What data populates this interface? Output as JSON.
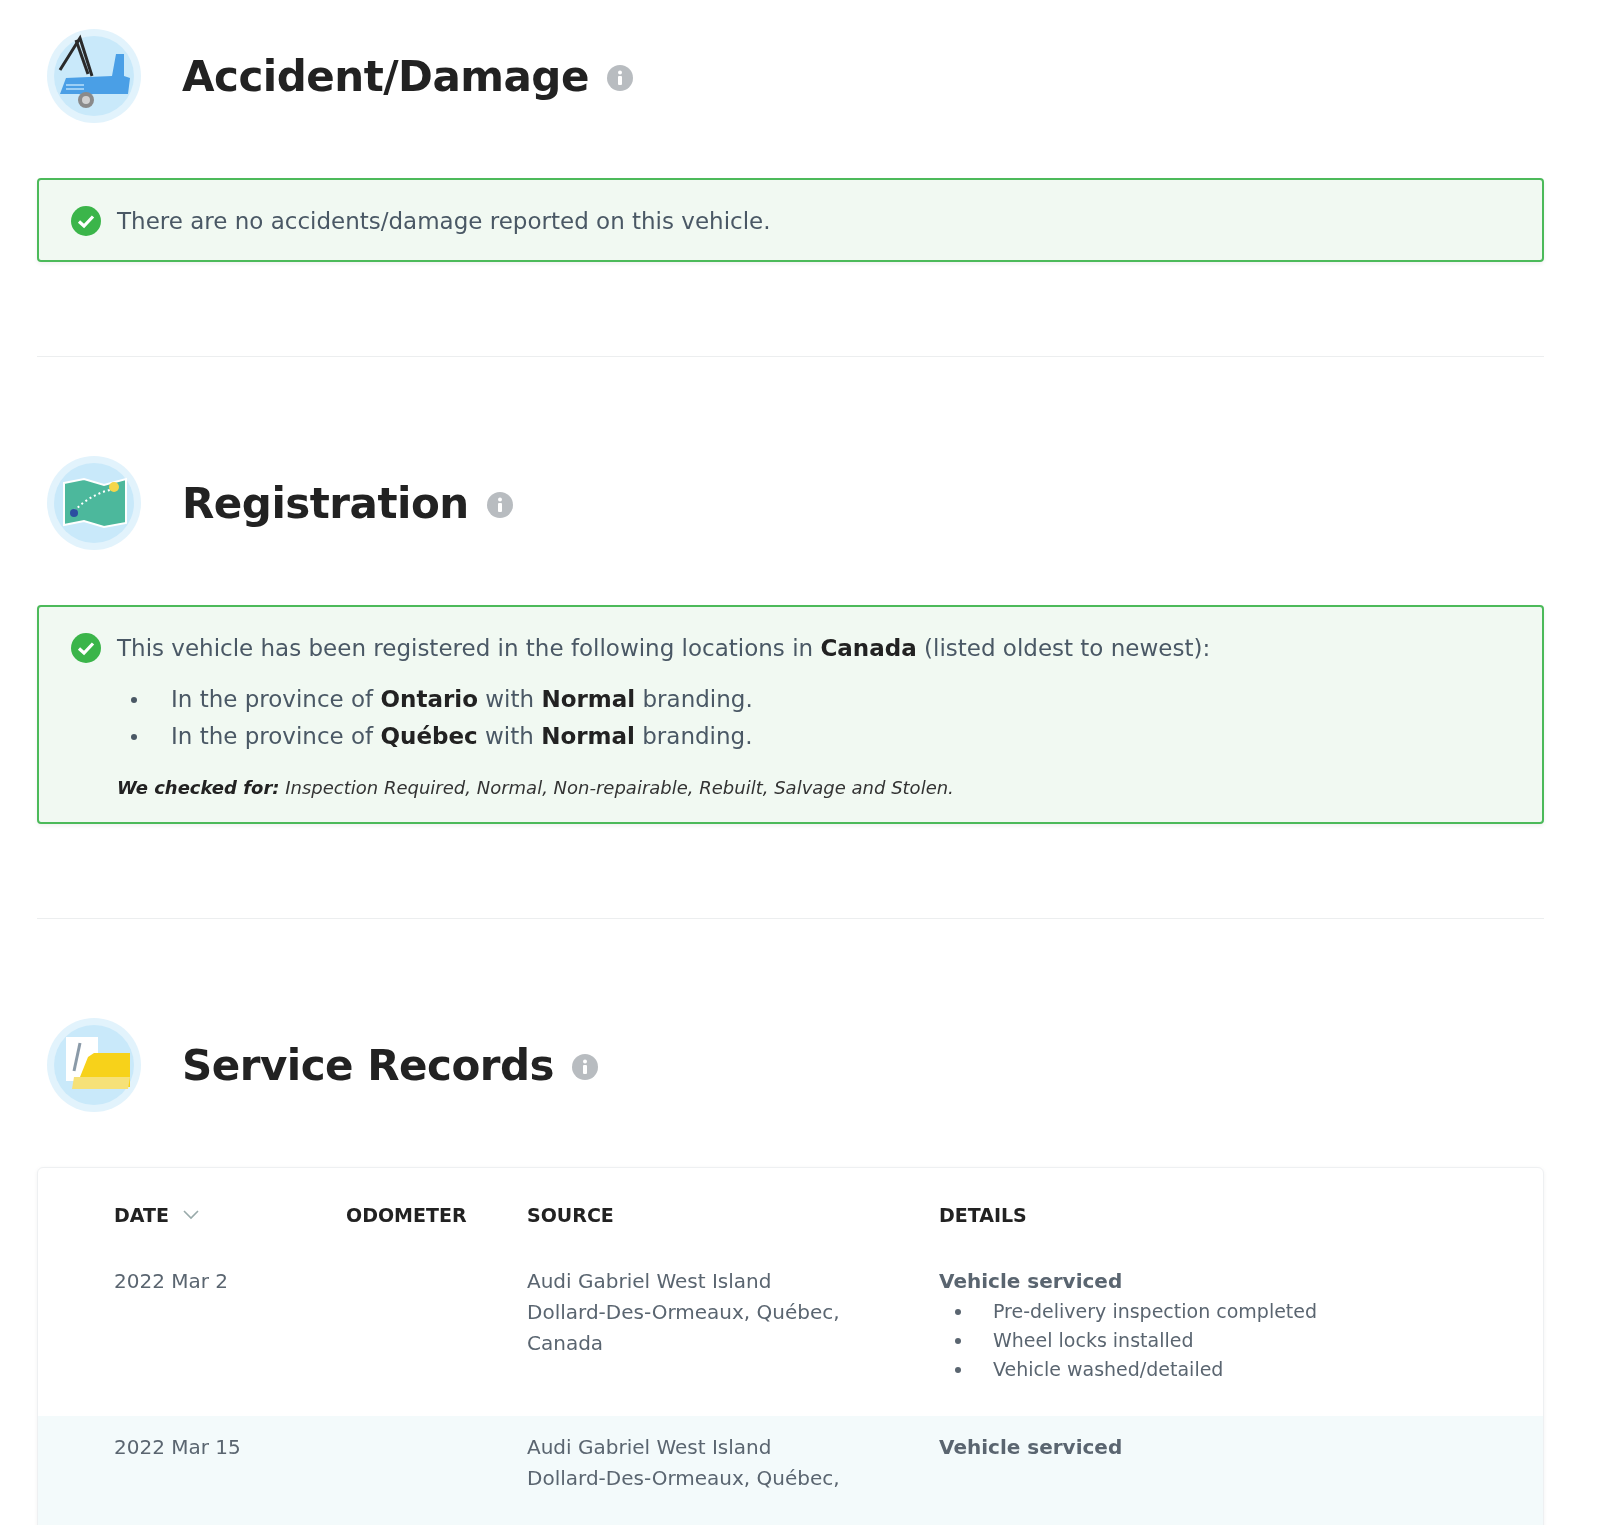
{
  "sections": [
    {
      "kind": "accident",
      "title": "Accident/Damage",
      "alert": {
        "passed": true,
        "text": "There are no accidents/damage reported on this vehicle."
      }
    },
    {
      "kind": "registration",
      "title": "Registration",
      "alert": {
        "passed": true,
        "text": "This vehicle has been registered in the following locations in **Canada** (listed oldest to newest):",
        "items": [
          "In the province of **Ontario** with **Normal** branding.",
          "In the province of **Québec** with **Normal** branding."
        ],
        "note": "**We checked for:** Inspection Required, Normal, Non-repairable, Rebuilt, Salvage and Stolen."
      }
    },
    {
      "kind": "service",
      "title": "Service Records",
      "table": {
        "columns": [
          {
            "label": "DATE",
            "sorted": true
          },
          {
            "label": "ODOMETER",
            "sorted": false
          },
          {
            "label": "SOURCE",
            "sorted": false
          },
          {
            "label": "DETAILS",
            "sorted": false
          }
        ],
        "rows": [
          {
            "date": "2022 Mar 2",
            "source": [
              "Audi Gabriel West Island",
              "Dollard-Des-Ormeaux, Québec,",
              "Canada"
            ],
            "details_title": "Vehicle serviced",
            "details": [
              "Pre-delivery inspection completed",
              "Wheel locks installed",
              "Vehicle washed/detailed"
            ]
          },
          {
            "date": "2022 Mar 15",
            "source": [
              "Audi Gabriel West Island",
              "Dollard-Des-Ormeaux, Québec,"
            ],
            "details_title": "Vehicle serviced",
            "details": []
          }
        ]
      }
    }
  ]
}
